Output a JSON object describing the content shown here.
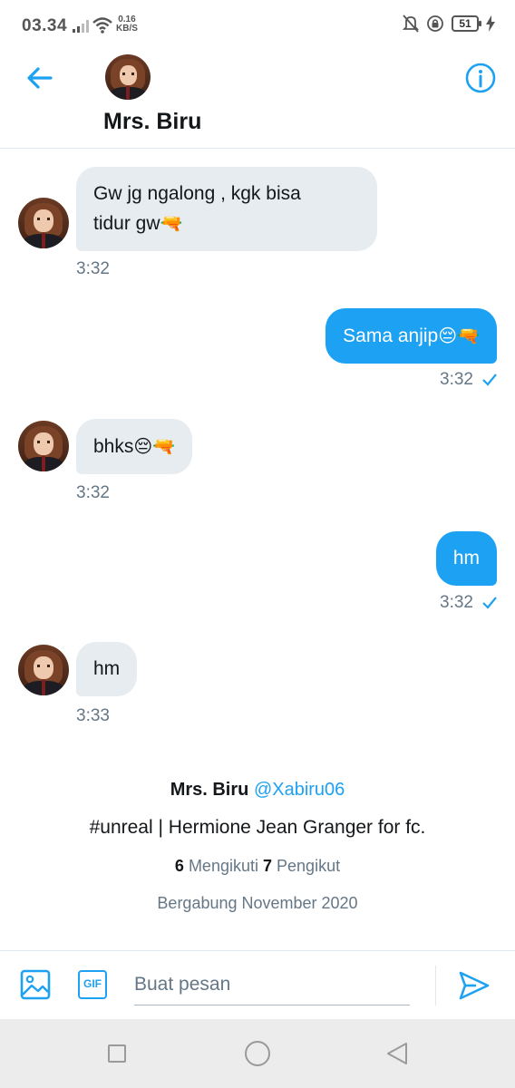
{
  "status_bar": {
    "time": "03.34",
    "net_speed_value": "0.16",
    "net_speed_unit": "KB/S",
    "battery": "51",
    "icons": [
      "signal-icon",
      "wifi-icon",
      "mute-bell-icon",
      "rotation-lock-icon",
      "battery-icon",
      "charging-icon"
    ]
  },
  "header": {
    "name": "Mrs. Biru",
    "back_icon": "arrow-left-icon",
    "info_icon": "info-icon"
  },
  "messages": [
    {
      "direction": "in",
      "lines": [
        "Gw jg ngalong , kgk bisa",
        "tidur gw"
      ],
      "emojis": [
        "water-pistol"
      ],
      "time": "3:32"
    },
    {
      "direction": "out",
      "text": "Sama anjip",
      "emojis": [
        "pensive-face",
        "water-pistol"
      ],
      "time": "3:32",
      "status": "sent"
    },
    {
      "direction": "in",
      "text": "bhks",
      "emojis": [
        "pensive-face",
        "water-pistol"
      ],
      "time": "3:32"
    },
    {
      "direction": "out",
      "text": "hm",
      "time": "3:32",
      "status": "sent"
    },
    {
      "direction": "in",
      "text": "hm",
      "time": "3:33"
    }
  ],
  "profile": {
    "name": "Mrs. Biru",
    "handle": "@Xabiru06",
    "bio": "#unreal | Hermione Jean Granger for fc.",
    "following_count": "6",
    "following_label": "Mengikuti",
    "followers_count": "7",
    "followers_label": "Pengikut",
    "joined": "Bergabung November 2020"
  },
  "compose": {
    "placeholder": "Buat pesan",
    "gif_label": "GIF"
  },
  "colors": {
    "accent": "#1da1f2",
    "incoming_bubble": "#e6ecf0",
    "muted_text": "#657786"
  }
}
